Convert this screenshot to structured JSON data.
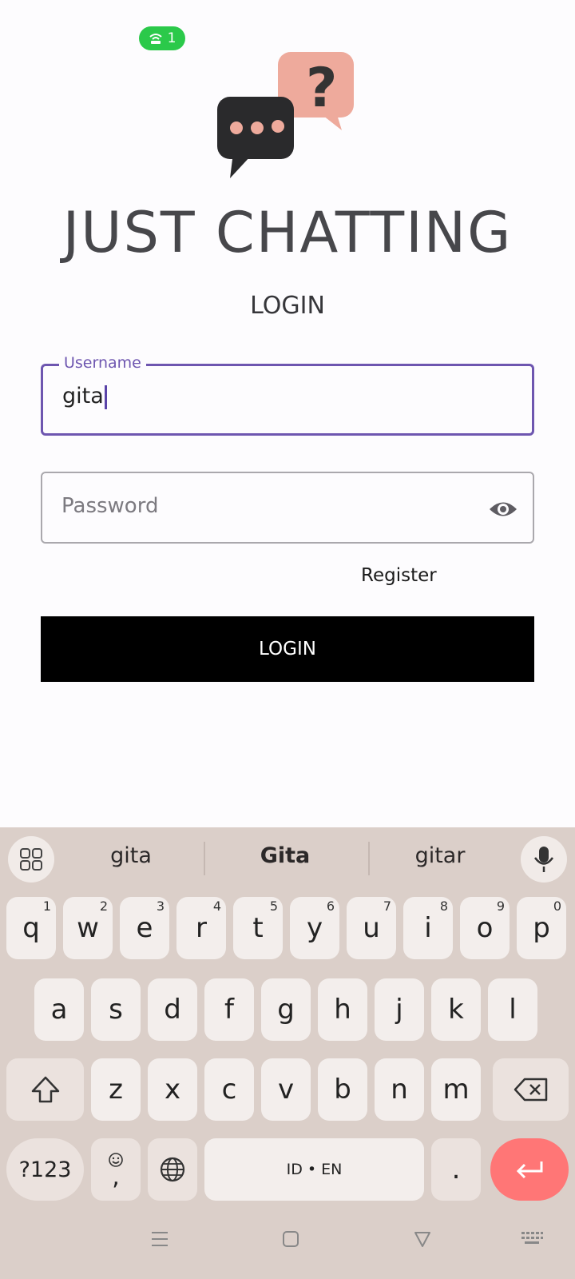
{
  "status": {
    "hotspot_count": "1",
    "pill_color": "#2bc94a"
  },
  "app": {
    "title": "JUST CHATTING",
    "heading": "LOGIN"
  },
  "form": {
    "username": {
      "label": "Username",
      "value": "gita"
    },
    "password": {
      "placeholder": "Password",
      "value": ""
    },
    "register_label": "Register",
    "login_button_label": "LOGIN"
  },
  "colors": {
    "accent": "#6e56b0",
    "enter_key": "#ff7676",
    "keyboard_bg": "#dbcfc9"
  },
  "keyboard": {
    "suggestions": [
      "gita",
      "Gita",
      "gitar"
    ],
    "row1": [
      {
        "k": "q",
        "h": "1"
      },
      {
        "k": "w",
        "h": "2"
      },
      {
        "k": "e",
        "h": "3"
      },
      {
        "k": "r",
        "h": "4"
      },
      {
        "k": "t",
        "h": "5"
      },
      {
        "k": "y",
        "h": "6"
      },
      {
        "k": "u",
        "h": "7"
      },
      {
        "k": "i",
        "h": "8"
      },
      {
        "k": "o",
        "h": "9"
      },
      {
        "k": "p",
        "h": "0"
      }
    ],
    "row2": [
      "a",
      "s",
      "d",
      "f",
      "g",
      "h",
      "j",
      "k",
      "l"
    ],
    "row3": [
      "z",
      "x",
      "c",
      "v",
      "b",
      "n",
      "m"
    ],
    "symbols_label": "?123",
    "comma_label": ",",
    "space_label": "ID • EN",
    "period_label": "."
  },
  "icons": {
    "hotspot": "hotspot-icon",
    "password_toggle": "eye-icon",
    "apps": "grid-icon",
    "mic": "microphone-icon",
    "shift": "shift-icon",
    "backspace": "backspace-icon",
    "emoji": "emoji-icon",
    "language": "globe-icon",
    "enter": "enter-icon",
    "nav_menu": "menu-icon",
    "nav_home": "home-icon",
    "nav_back": "back-icon",
    "nav_keyboard": "keyboard-icon"
  }
}
